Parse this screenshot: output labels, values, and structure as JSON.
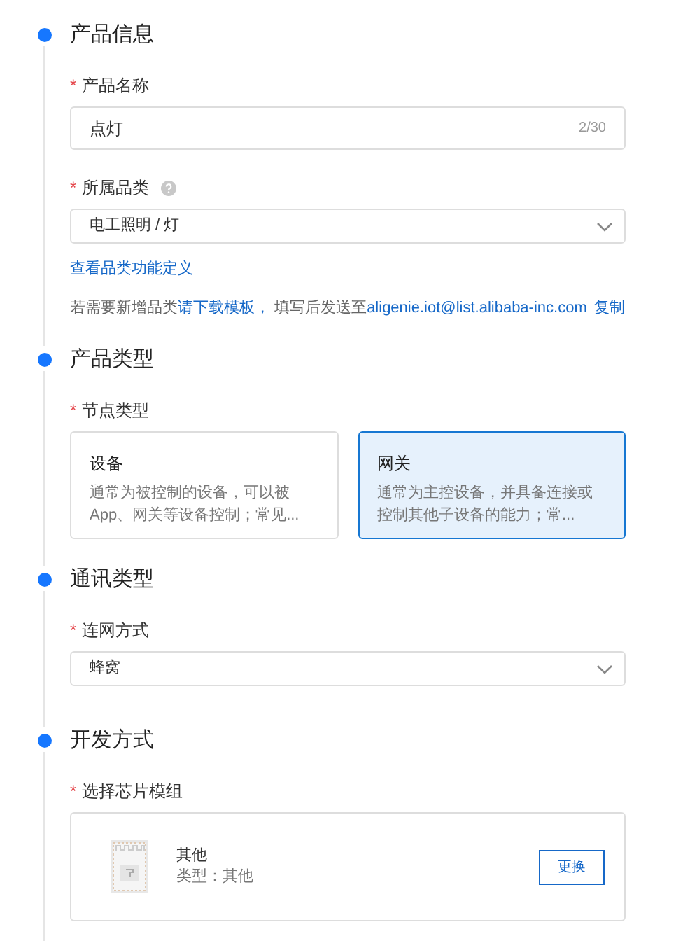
{
  "sections": [
    {
      "title": "产品信息",
      "fields": [
        {
          "kind": "input",
          "mark": "*",
          "label": "产品名称",
          "value": "点灯",
          "counter": "2/30"
        },
        {
          "kind": "select",
          "mark": "*",
          "label": "所属品类",
          "help": true,
          "value": "电工照明 / 灯"
        },
        {
          "kind": "link",
          "text": "查看品类功能定义"
        },
        {
          "kind": "note",
          "parts": [
            {
              "kind": "text",
              "text": "若需要新增品类"
            },
            {
              "kind": "link",
              "text": "请下载模板，"
            },
            {
              "kind": "text",
              "text": " 填写后发送至"
            },
            {
              "kind": "link",
              "text": "aligenie.iot@list.alibaba-inc.com"
            },
            {
              "kind": "link",
              "text": "复制"
            }
          ]
        }
      ]
    },
    {
      "title": "产品类型",
      "fields": [
        {
          "kind": "cards",
          "mark": "*",
          "label": "节点类型",
          "options": [
            {
              "title": "设备",
              "desc": "通常为被控制的设备，可以被App、网关等设备控制；常见...",
              "selected": false
            },
            {
              "title": "网关",
              "desc": "通常为主控设备，并具备连接或控制其他子设备的能力；常...",
              "selected": true
            }
          ]
        }
      ]
    },
    {
      "title": "通讯类型",
      "fields": [
        {
          "kind": "select",
          "mark": "*",
          "label": "连网方式",
          "value": "蜂窝"
        }
      ]
    },
    {
      "title": "开发方式",
      "fields": [
        {
          "kind": "module",
          "mark": "*",
          "label": "选择芯片模组",
          "name": "其他",
          "type": "类型：其他",
          "button": "更换"
        }
      ]
    }
  ]
}
